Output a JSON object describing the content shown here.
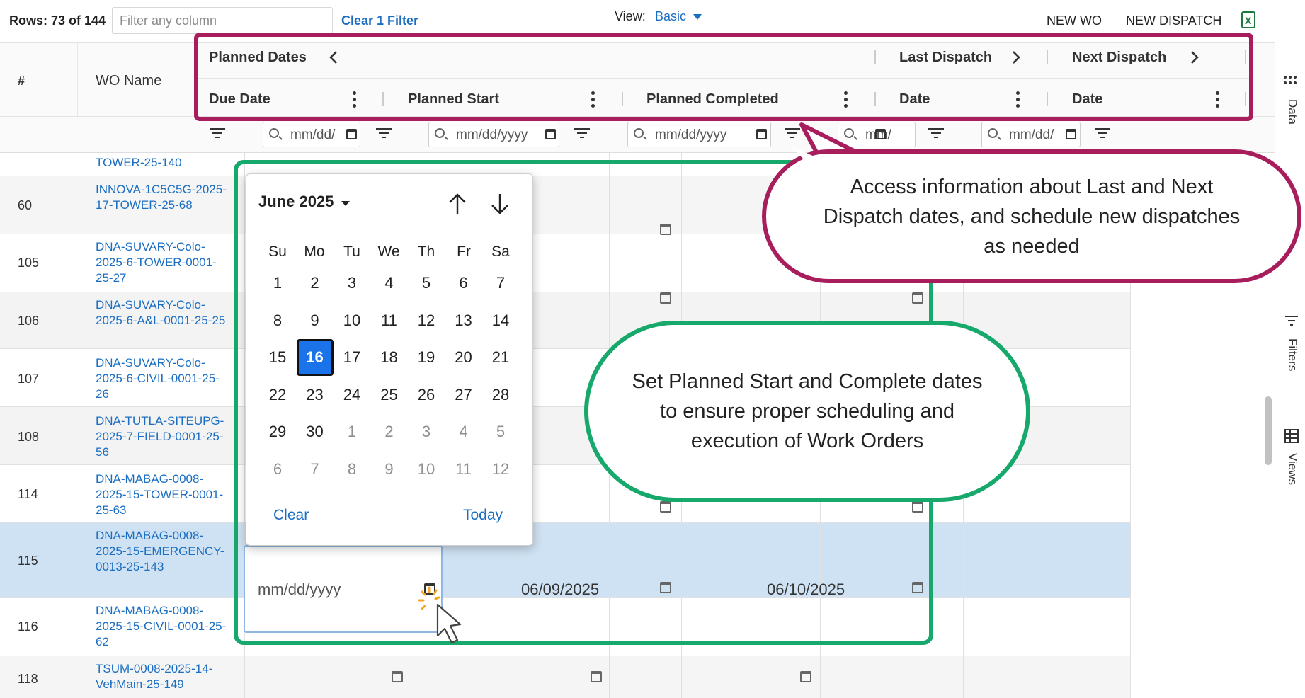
{
  "toolbar": {
    "rows_count": "Rows: 73 of 144",
    "filter_placeholder": "Filter any column",
    "clear_filter": "Clear 1 Filter",
    "view_label": "View:",
    "view_value": "Basic",
    "new_wo": "NEW WO",
    "new_dispatch": "NEW DISPATCH"
  },
  "columns": {
    "num": "#",
    "wo_name": "WO Name",
    "group_planned": "Planned Dates",
    "group_last": "Last Dispatch",
    "group_next": "Next Dispatch",
    "due_date": "Due Date",
    "planned_start": "Planned Start",
    "planned_completed": "Planned Completed",
    "last_date": "Date",
    "next_date": "Date"
  },
  "date_filters": {
    "f1": "mm/dd/",
    "f2": "mm/dd/yyyy",
    "f3": "mm/dd/yyyy",
    "f4": "mm/",
    "f5": "mm/dd/"
  },
  "rows": [
    {
      "num": "",
      "wo": "TOWER-25-140"
    },
    {
      "num": "60",
      "wo": "INNOVA-1C5C5G-2025-17-TOWER-25-68"
    },
    {
      "num": "105",
      "wo": "DNA-SUVARY-Colo-2025-6-TOWER-0001-25-27"
    },
    {
      "num": "106",
      "wo": "DNA-SUVARY-Colo-2025-6-A&L-0001-25-25"
    },
    {
      "num": "107",
      "wo": "DNA-SUVARY-Colo-2025-6-CIVIL-0001-25-26"
    },
    {
      "num": "108",
      "wo": "DNA-TUTLA-SITEUPG-2025-7-FIELD-0001-25-56"
    },
    {
      "num": "114",
      "wo": "DNA-MABAG-0008-2025-15-TOWER-0001-25-63"
    },
    {
      "num": "115",
      "wo": "DNA-MABAG-0008-2025-15-EMERGENCY-0013-25-143"
    },
    {
      "num": "116",
      "wo": "DNA-MABAG-0008-2025-15-CIVIL-0001-25-62"
    },
    {
      "num": "118",
      "wo": "TSUM-0008-2025-14-VehMain-25-149"
    }
  ],
  "selected_row": {
    "due_placeholder": "mm/dd/yyyy",
    "planned_start": "06/09/2025",
    "planned_completed": "06/10/2025"
  },
  "calendar": {
    "month": "June 2025",
    "weekdays": [
      "Su",
      "Mo",
      "Tu",
      "We",
      "Th",
      "Fr",
      "Sa"
    ],
    "weeks": [
      [
        "1",
        "2",
        "3",
        "4",
        "5",
        "6",
        "7"
      ],
      [
        "8",
        "9",
        "10",
        "11",
        "12",
        "13",
        "14"
      ],
      [
        "15",
        "16",
        "17",
        "18",
        "19",
        "20",
        "21"
      ],
      [
        "22",
        "23",
        "24",
        "25",
        "26",
        "27",
        "28"
      ],
      [
        "29",
        "30",
        "1",
        "2",
        "3",
        "4",
        "5"
      ],
      [
        "6",
        "7",
        "8",
        "9",
        "10",
        "11",
        "12"
      ]
    ],
    "selected": "16",
    "clear": "Clear",
    "today": "Today"
  },
  "right_rail": {
    "data": "Data",
    "filters": "Filters",
    "views": "Views"
  },
  "callouts": {
    "dispatch": "Access information about Last and Next Dispatch dates, and schedule new dispatches as needed",
    "planned": "Set Planned Start and Complete dates to ensure proper scheduling and execution of Work Orders"
  },
  "colors": {
    "accent_blue": "#1b6ec2",
    "magenta": "#a81e5d",
    "green": "#17a86b",
    "selected_row": "#cfe2f3",
    "selected_day": "#1a73e8"
  }
}
